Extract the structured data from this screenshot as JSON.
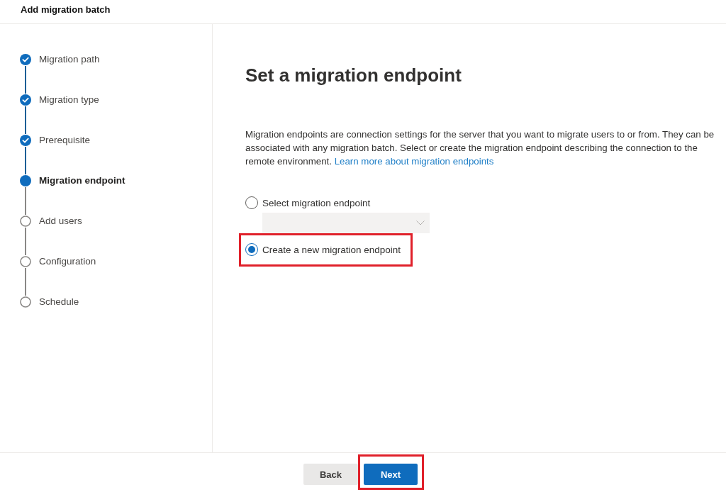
{
  "dialog": {
    "title": "Add migration batch"
  },
  "steps": [
    {
      "label": "Migration path",
      "completed": true,
      "current": false
    },
    {
      "label": "Migration type",
      "completed": true,
      "current": false
    },
    {
      "label": "Prerequisite",
      "completed": true,
      "current": false
    },
    {
      "label": "Migration endpoint",
      "completed": false,
      "current": true
    },
    {
      "label": "Add users",
      "completed": false,
      "current": false
    },
    {
      "label": "Configuration",
      "completed": false,
      "current": false
    },
    {
      "label": "Schedule",
      "completed": false,
      "current": false
    }
  ],
  "page": {
    "heading": "Set a migration endpoint",
    "description": "Migration endpoints are connection settings for the server that you want to migrate users to or from. They can be associated with any migration batch. Select or create the migration endpoint describing the connection to the remote environment.",
    "link": "Learn more about migration endpoints"
  },
  "options": [
    {
      "label": "Select migration endpoint",
      "selected": false,
      "highlighted": false,
      "dropdown": {
        "disabled": true
      }
    },
    {
      "label": "Create a new migration endpoint",
      "selected": true,
      "highlighted": true
    }
  ],
  "buttons": [
    {
      "label": "Back",
      "kind": "secondary",
      "highlighted": false
    },
    {
      "label": "Next",
      "kind": "primary",
      "highlighted": true
    }
  ]
}
